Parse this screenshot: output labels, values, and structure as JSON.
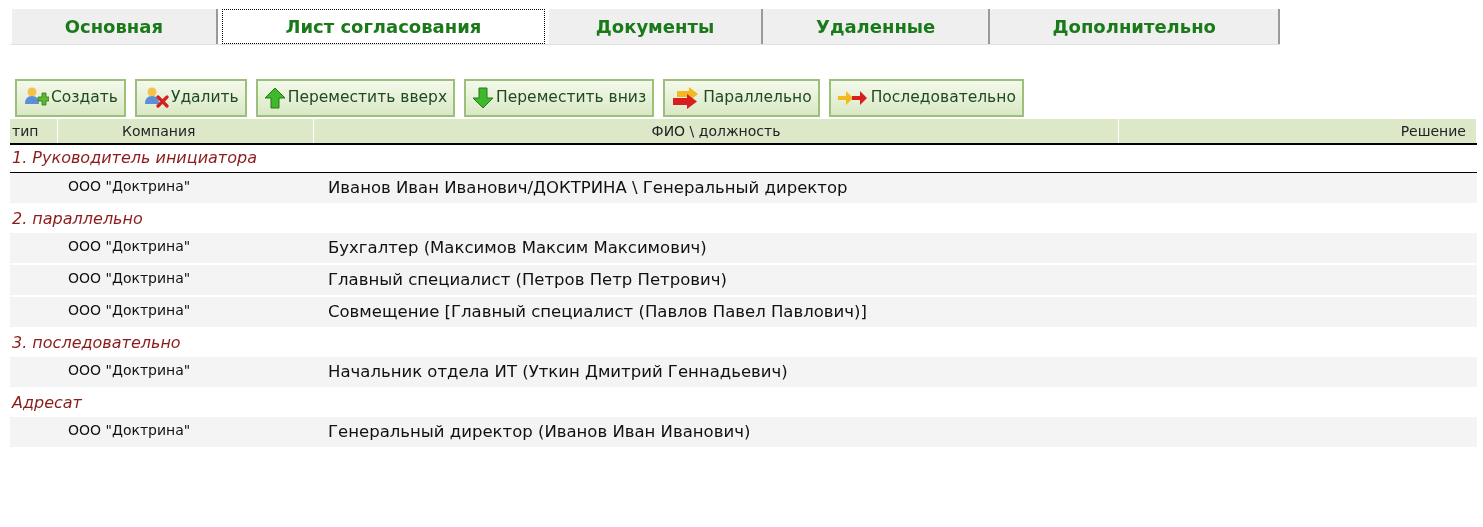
{
  "tabs": [
    {
      "label": "Основная",
      "selected": false
    },
    {
      "label": "Лист согласования",
      "selected": true
    },
    {
      "label": "Документы",
      "selected": false
    },
    {
      "label": "Удаленные",
      "selected": false
    },
    {
      "label": "Дополнительно",
      "selected": false
    }
  ],
  "toolbar": [
    {
      "label": "Создать",
      "kind": "create"
    },
    {
      "label": "Удалить",
      "kind": "delete"
    },
    {
      "label": "Переместить вверх",
      "kind": "up"
    },
    {
      "label": "Переместить вниз",
      "kind": "down"
    },
    {
      "label": "Параллельно",
      "kind": "parallel"
    },
    {
      "label": "Последовательно",
      "kind": "sequential"
    }
  ],
  "table": {
    "columns": [
      "тип",
      "Компания",
      "ФИО \\ должность",
      "Решение"
    ],
    "groups": [
      {
        "title": "1. Руководитель инициатора",
        "rows": [
          {
            "company": "ООО \"Доктрина\"",
            "person": "Иванов Иван Иванович/ДОКТРИНА \\ Генеральный директор"
          }
        ]
      },
      {
        "title": "2. параллельно",
        "rows": [
          {
            "company": "ООО \"Доктрина\"",
            "person": "Бухгалтер (Максимов Максим Максимович)"
          },
          {
            "company": "ООО \"Доктрина\"",
            "person": "Главный специалист (Петров Петр Петрович)"
          },
          {
            "company": "ООО \"Доктрина\"",
            "person": "Совмещение [Главный специалист (Павлов Павел Павлович)]"
          }
        ]
      },
      {
        "title": "3. последовательно",
        "rows": [
          {
            "company": "ООО \"Доктрина\"",
            "person": "Начальник отдела ИТ (Уткин Дмитрий Геннадьевич)"
          }
        ]
      },
      {
        "title": "Адресат",
        "rows": [
          {
            "company": "ООО \"Доктрина\"",
            "person": "Генеральный директор (Иванов Иван Иванович)"
          }
        ]
      }
    ]
  }
}
